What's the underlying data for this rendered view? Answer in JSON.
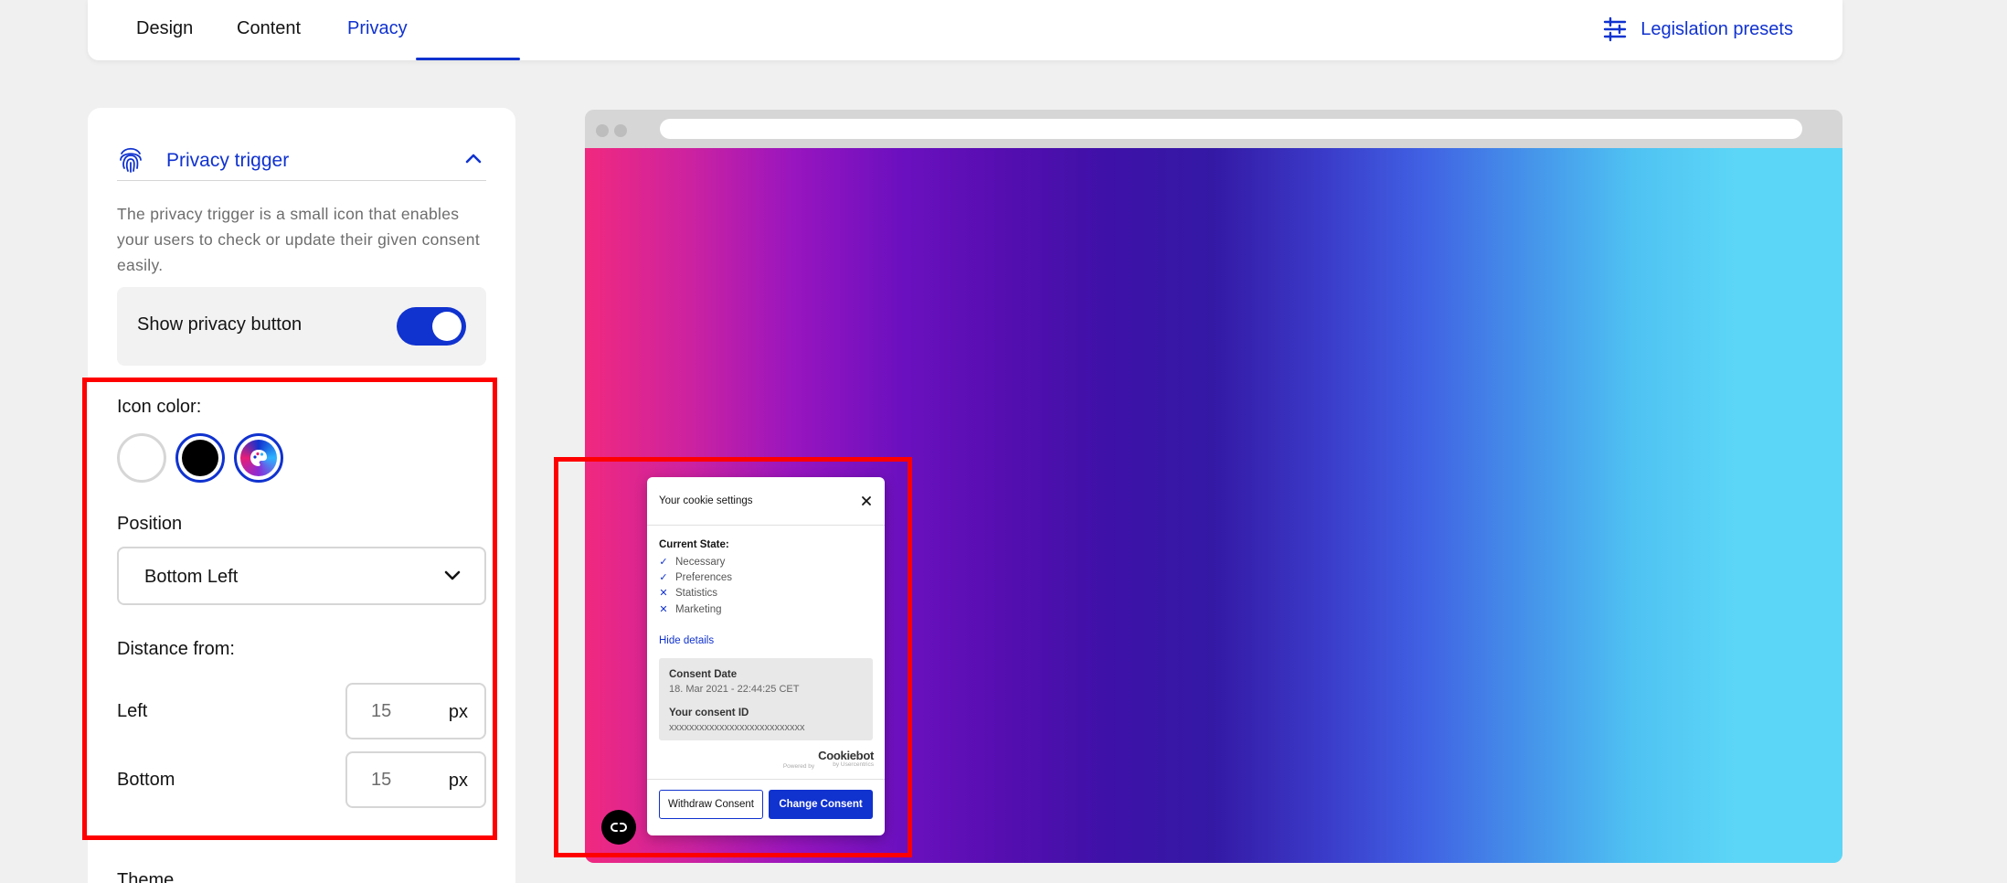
{
  "tabs": [
    {
      "label": "Design",
      "active": false
    },
    {
      "label": "Content",
      "active": false
    },
    {
      "label": "Privacy",
      "active": true
    }
  ],
  "header": {
    "legislation_label": "Legislation presets",
    "legislation_icon": "sliders-icon"
  },
  "panel": {
    "title": "Privacy trigger",
    "title_icon": "fingerprint-icon",
    "description": "The privacy trigger is a small icon that enables your users to check or update their given consent easily.",
    "show_button_label": "Show privacy button",
    "show_button_enabled": true,
    "icon_color_label": "Icon color:",
    "icon_color_options": [
      "white",
      "black",
      "custom"
    ],
    "icon_color_selected": "black",
    "position_label": "Position",
    "position_value": "Bottom Left",
    "distance_label": "Distance from:",
    "left_label": "Left",
    "left_value": "15",
    "bottom_label": "Bottom",
    "bottom_value": "15",
    "unit": "px",
    "theme_label": "Theme"
  },
  "preview": {
    "stripe_colors": [
      "#f0297f",
      "#cc22a0",
      "#9815bf",
      "#6c10bf",
      "#550eb0",
      "#3e11a8",
      "#3419a5",
      "#3a39c7",
      "#4061e3",
      "#4593ea",
      "#4fc2f2",
      "#5cd6f7"
    ],
    "popup": {
      "title": "Your cookie settings",
      "state_label": "Current State:",
      "items": [
        {
          "label": "Necessary",
          "mark": "✓"
        },
        {
          "label": "Preferences",
          "mark": "✓"
        },
        {
          "label": "Statistics",
          "mark": "✕"
        },
        {
          "label": "Marketing",
          "mark": "✕"
        }
      ],
      "hide_details": "Hide details",
      "consent_date_label": "Consent Date",
      "consent_date_value": "18. Mar 2021 - 22:44:25 CET",
      "consent_id_label": "Your consent ID",
      "consent_id_value": "xxxxxxxxxxxxxxxxxxxxxxxxxxx",
      "powered_by": "Powered by",
      "brand": "Cookiebot",
      "brand_sub": "by Usercentrics",
      "withdraw_label": "Withdraw Consent",
      "change_label": "Change Consent"
    }
  },
  "colors": {
    "accent": "#1032cf",
    "highlight": "#ff0000"
  }
}
